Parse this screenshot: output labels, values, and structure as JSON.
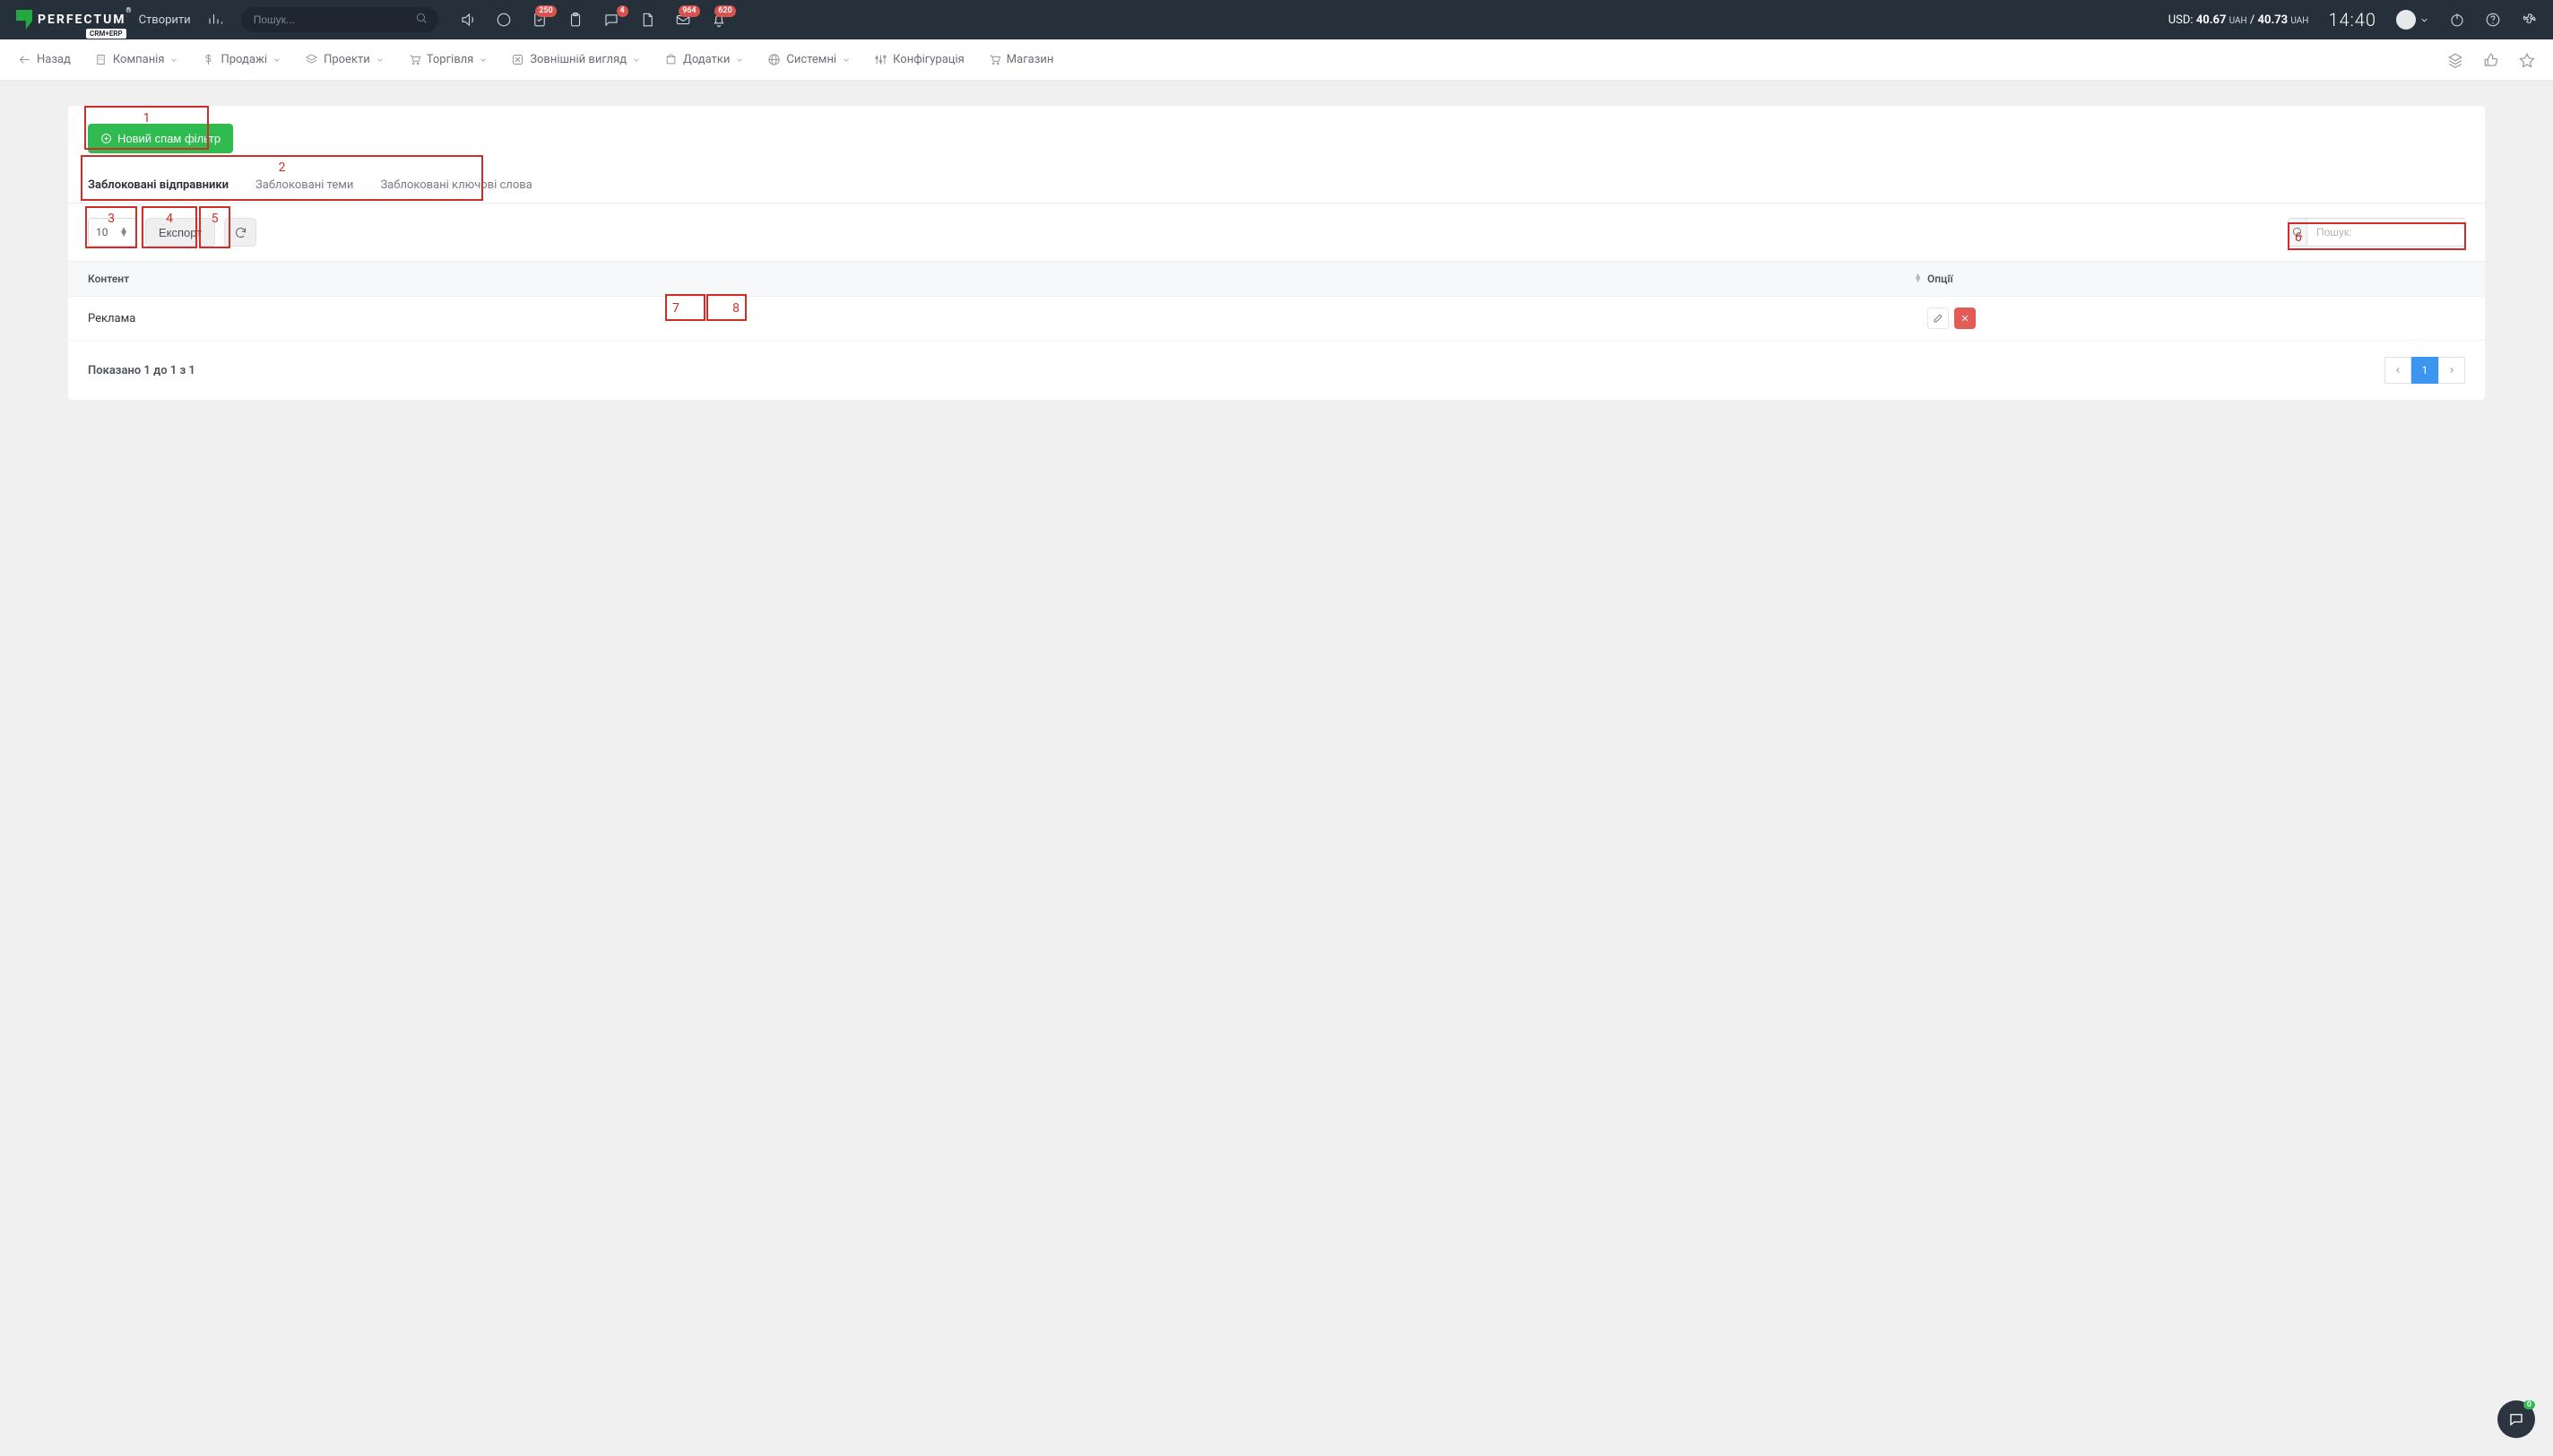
{
  "header": {
    "brand": "PERFECTUM",
    "brand_sub": "CRM+ERP",
    "create_label": "Створити",
    "search_placeholder": "Пошук...",
    "badges": {
      "tasks": "250",
      "messages": "4",
      "mail": "964",
      "bell": "620"
    },
    "rate_prefix": "USD:",
    "rate1_val": "40.67",
    "rate1_cur": "UAH",
    "rate_sep": " / ",
    "rate2_val": "40.73",
    "rate2_cur": "UAH",
    "time": "14:40"
  },
  "nav": {
    "back": "Назад",
    "items": [
      "Компанія",
      "Продажі",
      "Проекти",
      "Торгівля",
      "Зовнішній вигляд",
      "Додатки",
      "Системні",
      "Конфігурація",
      "Магазин"
    ]
  },
  "panel": {
    "new_filter_btn": "Новий спам фільтр",
    "tabs": [
      "Заблоковані відправники",
      "Заблоковані теми",
      "Заблоковані ключові слова"
    ],
    "active_tab_index": 0,
    "page_size": "10",
    "export_btn": "Експорт",
    "search_label": "Пошук:",
    "columns": {
      "content": "Контент",
      "options": "Опції"
    },
    "rows": [
      {
        "content": "Реклама"
      }
    ],
    "footer_info": "Показано 1 до 1 з 1",
    "page_current": "1"
  },
  "annotations": {
    "a1": "1",
    "a2": "2",
    "a3": "3",
    "a4": "4",
    "a5": "5",
    "a6": "6",
    "a7": "7",
    "a8": "8"
  },
  "fab_badge": "0"
}
